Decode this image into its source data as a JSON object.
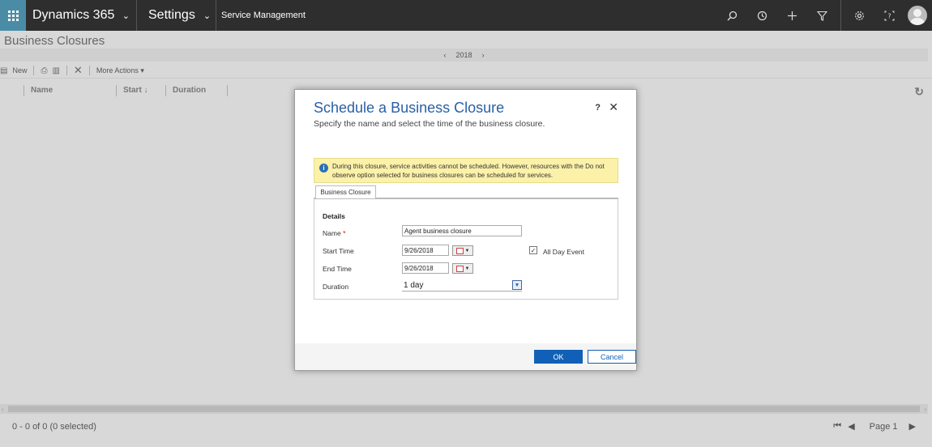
{
  "topbar": {
    "app_name": "Dynamics 365",
    "area": "Settings",
    "breadcrumb": "Service Management",
    "icons": [
      "search-icon",
      "recent-icon",
      "plus-icon",
      "filter-icon",
      "gear-icon",
      "help-icon",
      "user-avatar"
    ]
  },
  "page": {
    "title": "Business Closures",
    "year_prev": "‹",
    "year": "2018",
    "year_next": "›"
  },
  "toolbar": {
    "new_label": "New",
    "more_actions_label": "More Actions"
  },
  "grid": {
    "columns": [
      "Name",
      "Start ↓",
      "Duration"
    ]
  },
  "status": {
    "record_count": "0 - 0 of 0 (0 selected)",
    "page_label": "Page 1"
  },
  "dialog": {
    "title": "Schedule a Business Closure",
    "subtitle": "Specify the name and select the time of the business closure.",
    "help": "?",
    "close": "✕",
    "notice": "During this closure, service activities cannot be scheduled. However, resources with the Do not observe option selected for business closures can be scheduled for services.",
    "tab_label": "Business Closure",
    "section_label": "Details",
    "name_label": "Name",
    "required_mark": "*",
    "name_value": "Agent business closure",
    "start_label": "Start Time",
    "start_value": "9/26/2018",
    "end_label": "End Time",
    "end_value": "9/26/2018",
    "all_day_label": "All Day Event",
    "all_day_checked": true,
    "duration_label": "Duration",
    "duration_value": "1 day",
    "ok_label": "OK",
    "cancel_label": "Cancel"
  },
  "colors": {
    "topbar_bg": "#2e2e2e",
    "waffle_bg": "#4a8ca6",
    "title_blue": "#2a5fa5",
    "button_blue": "#1160b7",
    "notice_bg": "#fbf1a9",
    "overlay_bg": "#d8d8d8"
  }
}
